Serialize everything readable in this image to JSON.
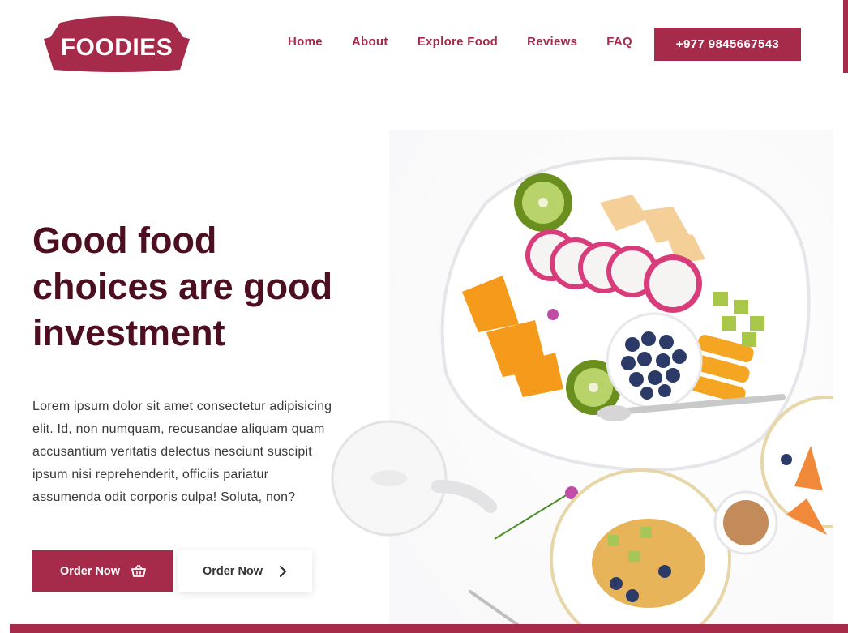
{
  "brand": {
    "logo_text": "FOODIES",
    "accent_color": "#a62a4a",
    "title_color": "#4d0f1f"
  },
  "nav": {
    "items": [
      {
        "label": "Home"
      },
      {
        "label": "About"
      },
      {
        "label": "Explore Food"
      },
      {
        "label": "Reviews"
      },
      {
        "label": "FAQ"
      }
    ],
    "phone": "+977 9845667543"
  },
  "hero": {
    "title_lines": [
      "Good food",
      "choices are good",
      "investment"
    ],
    "description": "Lorem ipsum dolor sit amet consectetur adipisicing elit. Id, non numquam, recusandae aliquam quam accusantium veritatis delectus nesciunt suscipit ipsum nisi reprehenderit, officiis pariatur assumenda odit corporis culpa! Soluta, non?",
    "primary_button": {
      "label": "Order Now",
      "icon": "basket-icon"
    },
    "secondary_button": {
      "label": "Order Now",
      "icon": "chevron-right-icon"
    }
  }
}
